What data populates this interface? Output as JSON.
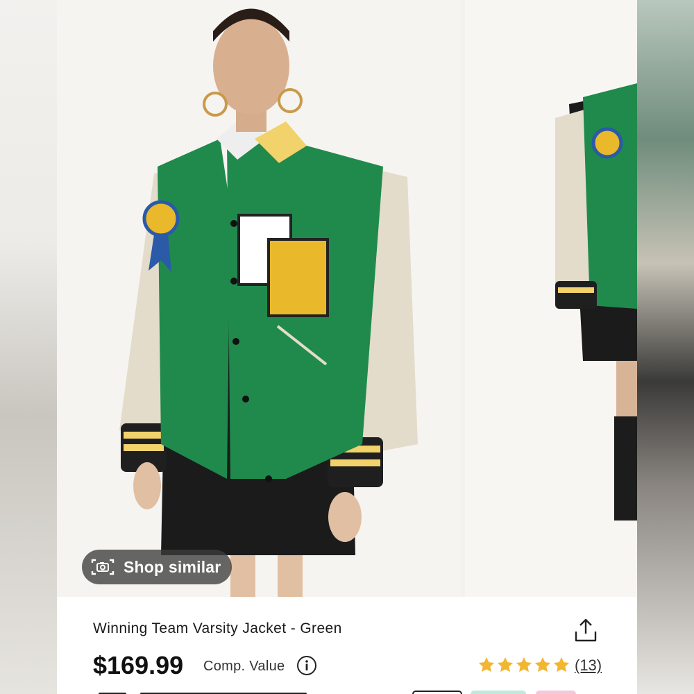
{
  "product": {
    "title": "Winning Team Varsity Jacket - Green",
    "price": "$169.99",
    "comp_value_label": "Comp. Value",
    "rating": {
      "stars": 5,
      "count": "(13)"
    }
  },
  "gallery": {
    "shop_similar_label": "Shop similar"
  },
  "icons": {
    "camera": "camera-icon",
    "share": "share-icon",
    "info": "info-icon",
    "star": "star-icon"
  },
  "colors": {
    "star": "#f2b632",
    "jacket_green": "#1f8a4c",
    "sleeve_cream": "#e3dccb"
  }
}
